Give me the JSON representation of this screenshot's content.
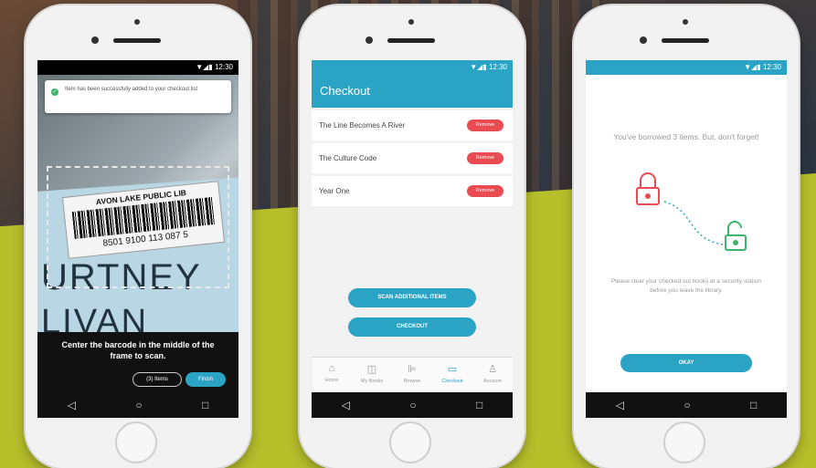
{
  "colors": {
    "accent": "#2aa3c4",
    "remove": "#e84b52",
    "lime": "#b7bf2b",
    "success": "#3bb56a"
  },
  "status_time": "12:30",
  "status_icons": "▼◢▮",
  "nav": {
    "back": "◁",
    "home": "○",
    "recents": "□"
  },
  "scan": {
    "toast": "Item has been successfully added to your checkout list",
    "label_title": "AVON LAKE PUBLIC LIB",
    "barcode_number": "8501 9100 113 087 5",
    "cover_line1": "URTNEY",
    "cover_line2": "LIVAN",
    "instruction": "Center the barcode in the middle of the frame to scan.",
    "items_button": "(3) Items",
    "finish_button": "Finish"
  },
  "checkout": {
    "title": "Checkout",
    "items": [
      {
        "title": "The Line Becomes A River",
        "action": "Remove"
      },
      {
        "title": "The Culture Code",
        "action": "Remove"
      },
      {
        "title": "Year One",
        "action": "Remove"
      }
    ],
    "scan_more_button": "SCAN ADDITIONAL ITEMS",
    "checkout_button": "CHECKOUT",
    "tabs": [
      {
        "icon": "home-icon",
        "glyph": "⌂",
        "label": "Home"
      },
      {
        "icon": "book-icon",
        "glyph": "◫",
        "label": "My Books"
      },
      {
        "icon": "browse-icon",
        "glyph": "⊫",
        "label": "Browse"
      },
      {
        "icon": "checkout-icon",
        "glyph": "▭",
        "label": "Checkout"
      },
      {
        "icon": "account-icon",
        "glyph": "♙",
        "label": "Account"
      }
    ]
  },
  "done": {
    "message": "You've borrowed 3 items. But, don't forget!",
    "instructions": "Please clear your checked out books at a security station before you leave the library.",
    "okay_button": "OKAY"
  }
}
